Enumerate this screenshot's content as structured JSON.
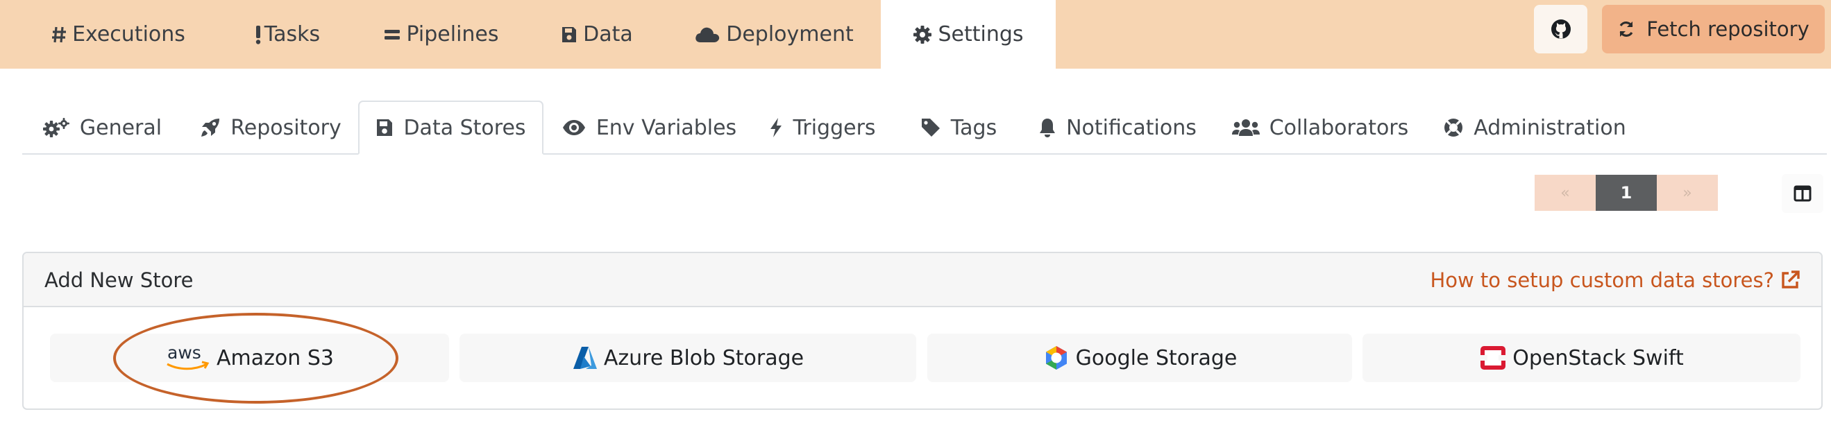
{
  "topnav": {
    "items": [
      {
        "label": "Executions",
        "icon": "hashtag-icon"
      },
      {
        "label": "Tasks",
        "icon": "exclamation-icon"
      },
      {
        "label": "Pipelines",
        "icon": "equals-icon"
      },
      {
        "label": "Data",
        "icon": "floppy-disk-icon"
      },
      {
        "label": "Deployment",
        "icon": "cloud-icon"
      },
      {
        "label": "Settings",
        "icon": "gear-icon"
      }
    ],
    "active": "Settings",
    "fetch_label": "Fetch repository"
  },
  "subtabs": {
    "items": [
      {
        "label": "General",
        "icon": "gears-icon"
      },
      {
        "label": "Repository",
        "icon": "rocket-icon"
      },
      {
        "label": "Data Stores",
        "icon": "floppy-disk-icon"
      },
      {
        "label": "Env Variables",
        "icon": "eye-icon"
      },
      {
        "label": "Triggers",
        "icon": "bolt-icon"
      },
      {
        "label": "Tags",
        "icon": "tag-icon"
      },
      {
        "label": "Notifications",
        "icon": "bell-icon"
      },
      {
        "label": "Collaborators",
        "icon": "users-icon"
      },
      {
        "label": "Administration",
        "icon": "life-ring-icon"
      }
    ],
    "active": "Data Stores"
  },
  "pagination": {
    "first": "«",
    "current": "1",
    "next": "»"
  },
  "card": {
    "title": "Add New Store",
    "help_link": "How to setup custom data stores?",
    "stores": [
      {
        "label": "Amazon S3",
        "logo_text": "aws"
      },
      {
        "label": "Azure Blob Storage"
      },
      {
        "label": "Google Storage"
      },
      {
        "label": "OpenStack Swift"
      }
    ]
  },
  "colors": {
    "topbar_bg": "#f7d5b2",
    "fetch_button_bg": "#f2b389",
    "link_color": "#c8561e",
    "highlight_ring": "#c5622a",
    "pager_current_bg": "#5c5e60"
  }
}
